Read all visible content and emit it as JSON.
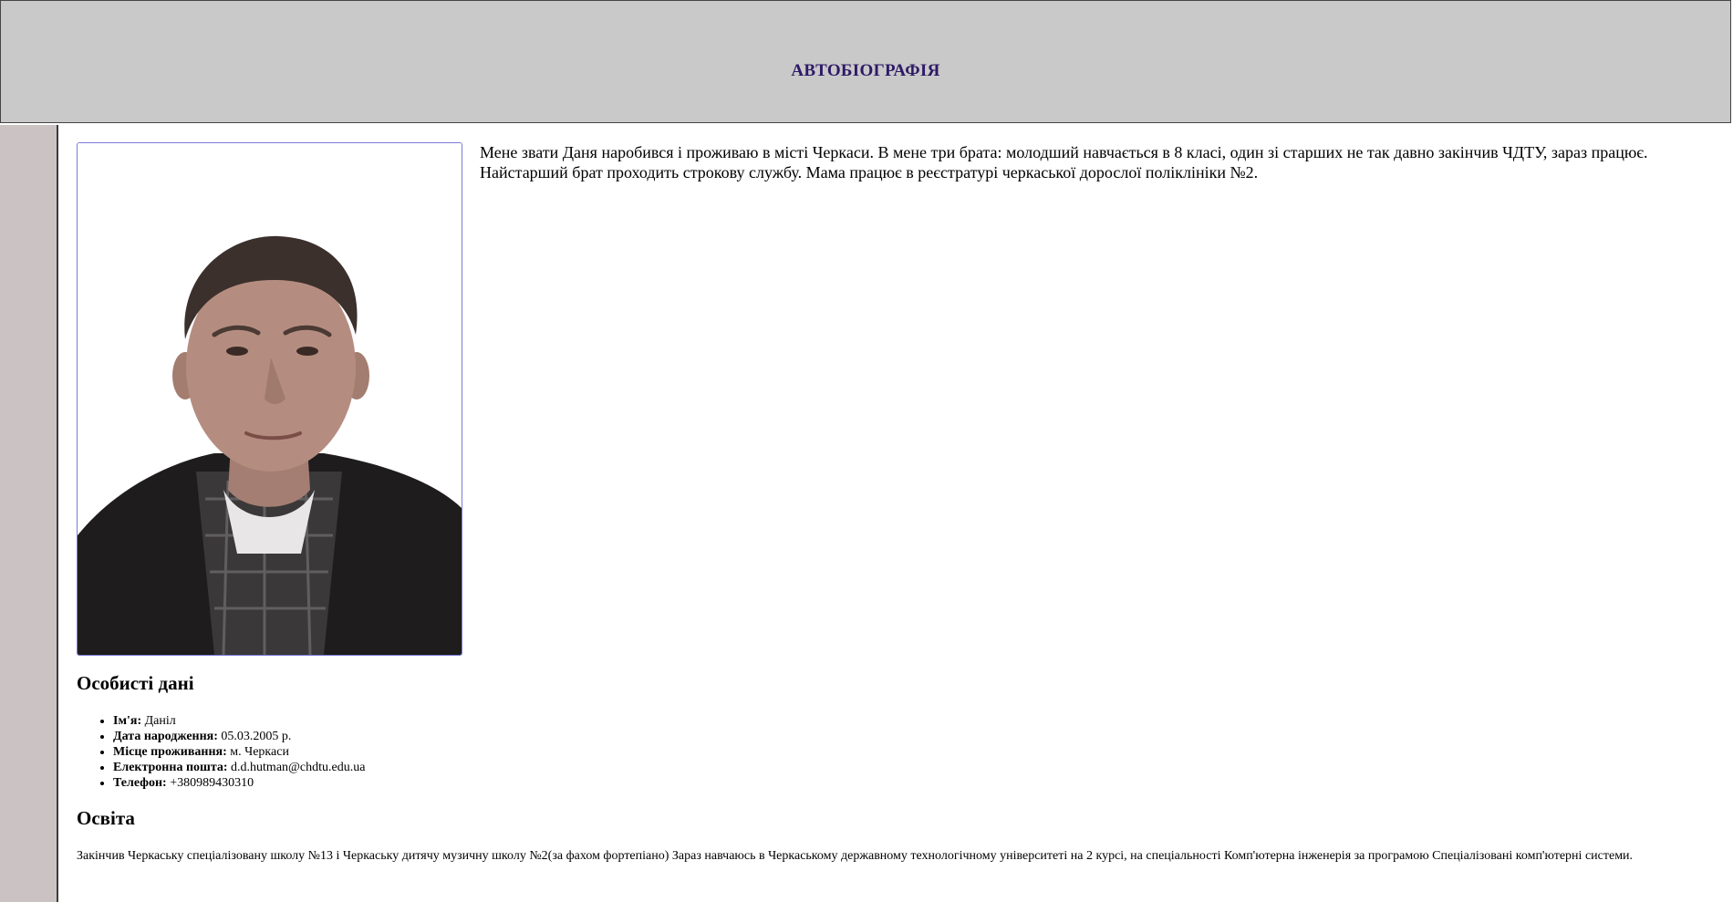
{
  "header": {
    "title": "АВТОБІОГРАФІЯ"
  },
  "profile": {
    "photo_icon": "person-portrait-photo",
    "intro": "Мене звати Даня наробився і проживаю в місті Черкаси. В мене три брата: молодший навчається в 8 класі, один зі старших не так давно закінчив ЧДТУ, зараз працює. Найстарший брат проходить строкову службу. Мама працює в реєстратурі черкаської дорослої поліклініки №2."
  },
  "personal": {
    "title": "Особисті дані",
    "items": [
      {
        "label": "Ім'я:",
        "value": "Даніл"
      },
      {
        "label": "Дата народження:",
        "value": "05.03.2005 р."
      },
      {
        "label": "Місце проживання:",
        "value": "м. Черкаси"
      },
      {
        "label": "Електронна пошта:",
        "value": "d.d.hutman@chdtu.edu.ua"
      },
      {
        "label": "Телефон:",
        "value": "+380989430310"
      }
    ]
  },
  "education": {
    "title": "Освіта",
    "text": "Закінчив Черкаську спеціалізовану школу №13 і Черкаську дитячу музичну школу №2(за фахом фортепіано) Зараз навчаюсь в Черкаському державному технологічному університеті на 2 курсі, на спеціальності Комп'ютерна інженерія за програмою Спеціалізовані комп'ютерні системи."
  },
  "colors": {
    "header_bg": "#c9c9c9",
    "header_title": "#2d1a66",
    "sidebar_bg": "#cbc3c3",
    "photo_border": "#7b7bd8"
  }
}
